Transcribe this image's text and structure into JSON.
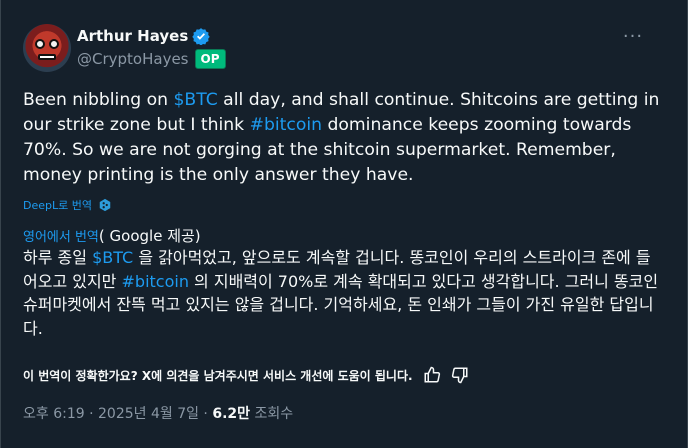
{
  "author": {
    "name": "Arthur Hayes",
    "handle": "@CryptoHayes",
    "badge": "OP"
  },
  "tweet": {
    "seg1": "Been nibbling on ",
    "tag1": "$BTC",
    "seg2": " all day, and shall continue. Shitcoins are getting in our strike zone but I think ",
    "tag2": "#bitcoin",
    "seg3": " dominance keeps zooming towards 70%. So we are not gorging at the shitcoin supermarket. Remember, money printing is the only answer they have."
  },
  "deepl": {
    "label": "DeepL로 번역"
  },
  "translation_header": {
    "lang": "영어에서 번역",
    "provider": "( Google 제공)"
  },
  "translation": {
    "seg1": "하루 종일 ",
    "tag1": "$BTC",
    "seg2": " 을 갉아먹었고, 앞으로도 계속할 겁니다. 똥코인이 우리의 스트라이크 존에 들어오고 있지만 ",
    "tag2": "#bitcoin",
    "seg3": " 의 지배력이 70%로 계속 확대되고 있다고 생각합니다. 그러니 똥코인 슈퍼마켓에서 잔뜩 먹고 있지는 않을 겁니다. 기억하세요, 돈 인쇄가 그들이 가진 유일한 답입니다."
  },
  "feedback": {
    "question": "이 번역이 정확한가요? X에 의견을 남겨주시면 서비스 개선에 도움이 됩니다."
  },
  "meta": {
    "time": "오후 6:19 · 2025년 4월 7일 · ",
    "views": "6.2만",
    "views_label": " 조회수"
  },
  "icons": {
    "verified": "verified-badge-icon",
    "more": "more-dots-icon",
    "deepl": "deepl-icon",
    "thumbs_up": "thumbs-up-icon",
    "thumbs_down": "thumbs-down-icon"
  },
  "colors": {
    "background": "#15202b",
    "accent": "#1d9bf0",
    "secondary_text": "#8b98a5",
    "op_badge": "#00ba7c"
  }
}
